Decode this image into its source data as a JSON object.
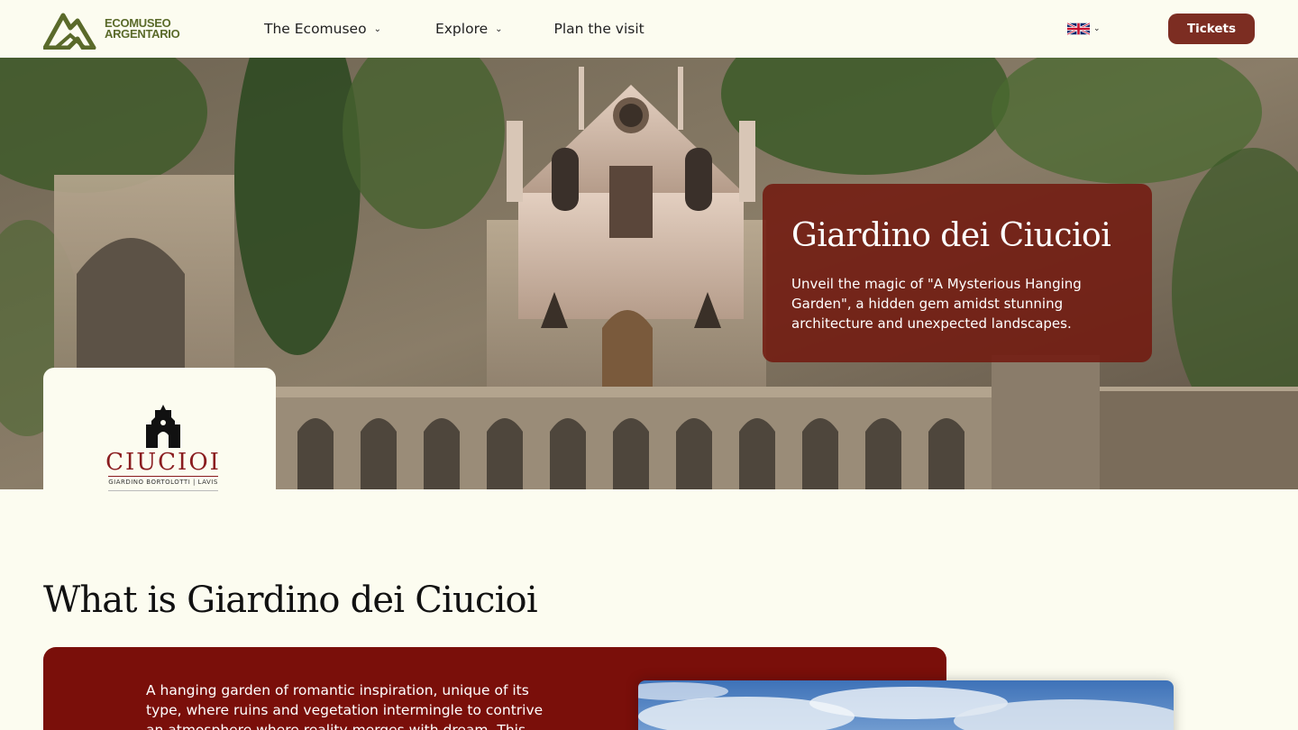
{
  "header": {
    "logo": {
      "line1": "ECOMUSEO",
      "line2": "ARGENTARIO"
    },
    "nav": [
      {
        "label": "The Ecomuseo",
        "has_dropdown": true
      },
      {
        "label": "Explore",
        "has_dropdown": true
      },
      {
        "label": "Plan the visit",
        "has_dropdown": false
      }
    ],
    "language": {
      "icon": "uk-flag-icon",
      "selected": "English"
    },
    "tickets_label": "Tickets"
  },
  "hero": {
    "title": "Giardino dei Ciucioi",
    "description": "Unveil the magic of \"A Mysterious Hanging Garden\", a hidden gem amidst stunning architecture and unexpected landscapes.",
    "badge": {
      "word": "CIUCIOI",
      "subtitle": "GIARDINO BORTOLOTTI | LAVIS"
    }
  },
  "section": {
    "title": "What is Giardino dei Ciucioi",
    "text": "A hanging garden of romantic inspiration, unique of its type, where ruins and  vegetation intermingle to contrive an atmosphere where reality merges with dream. This"
  },
  "colors": {
    "accent": "#7c2d22",
    "hero_card": "#721a10",
    "panel": "#7a0f0a",
    "background": "#fcfcf0",
    "logo_green": "#5a6a2a"
  }
}
